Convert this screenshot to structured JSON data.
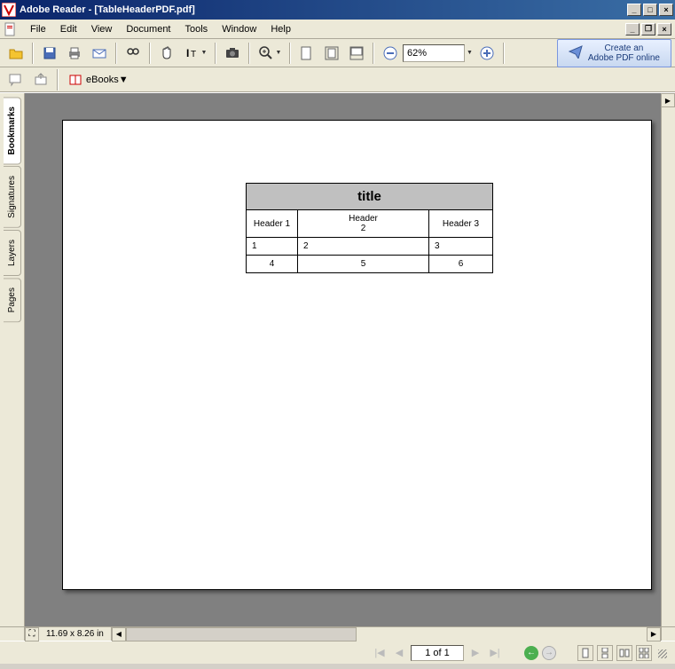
{
  "window": {
    "title": "Adobe Reader - [TableHeaderPDF.pdf]"
  },
  "menu": {
    "file": "File",
    "edit": "Edit",
    "view": "View",
    "document": "Document",
    "tools": "Tools",
    "window": "Window",
    "help": "Help"
  },
  "toolbar": {
    "zoom_value": "62%",
    "promo_line1": "Create an",
    "promo_line2": "Adobe PDF online",
    "ebooks_label": "eBooks"
  },
  "navtabs": {
    "bookmarks": "Bookmarks",
    "signatures": "Signatures",
    "layers": "Layers",
    "pages": "Pages"
  },
  "hscroll": {
    "dims": "11.69 x 8.26 in"
  },
  "status": {
    "page_label": "1 of 1"
  },
  "pdf": {
    "table": {
      "title": "title",
      "headers": {
        "h1": "Header 1",
        "h2a": "Header",
        "h2b": "2",
        "h3": "Header 3"
      },
      "rows": [
        {
          "c1": "1",
          "c2": "2",
          "c3": "3"
        },
        {
          "c1": "4",
          "c2": "5",
          "c3": "6"
        }
      ]
    }
  }
}
